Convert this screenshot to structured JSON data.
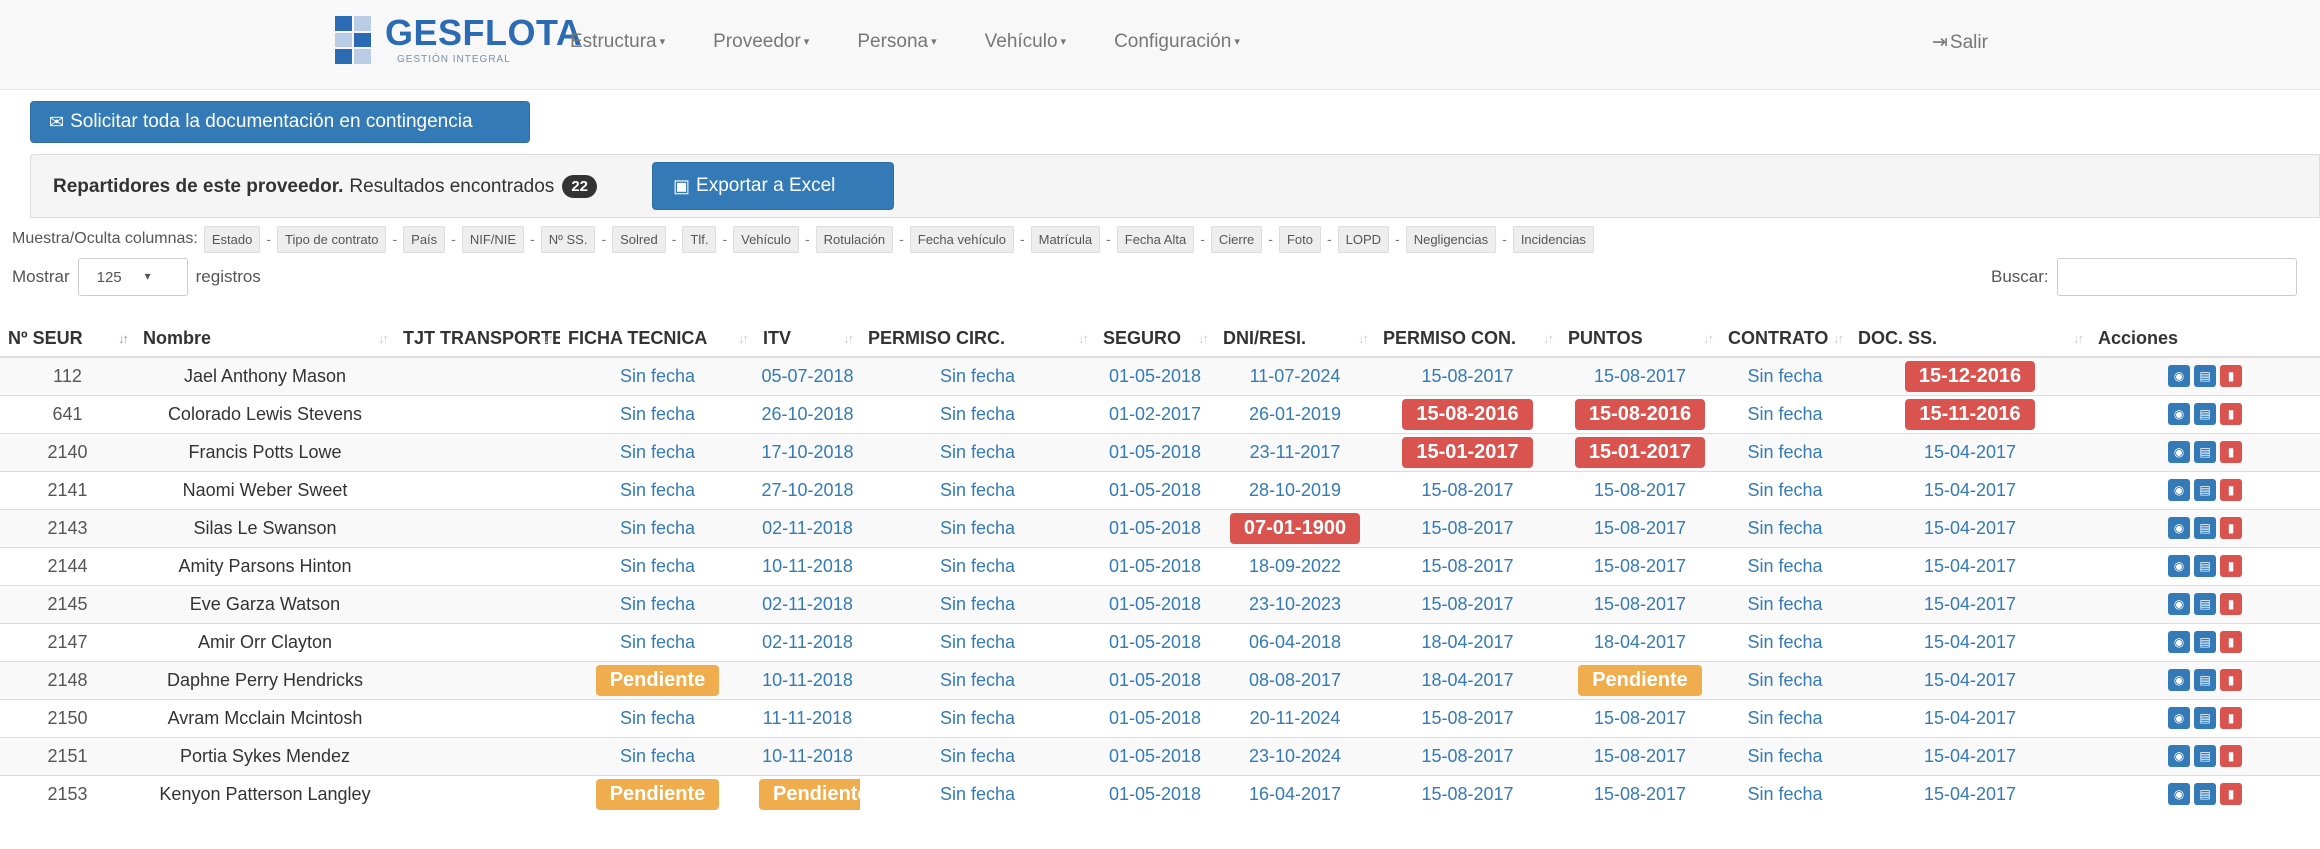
{
  "brand": {
    "name": "GESFLOTA",
    "subtitle": "GESTIÓN INTEGRAL"
  },
  "nav": {
    "items": [
      {
        "label": "Estructura"
      },
      {
        "label": "Proveedor"
      },
      {
        "label": "Persona"
      },
      {
        "label": "Vehículo"
      },
      {
        "label": "Configuración"
      }
    ],
    "logout": "Salir"
  },
  "contingency_button": "Solicitar toda la documentación en contingencia",
  "panel": {
    "title_bold": "Repartidores de este proveedor.",
    "title_rest": "Resultados encontrados",
    "count": "22",
    "export_label": "Exportar a Excel"
  },
  "column_toggle": {
    "label": "Muestra/Oculta columnas:",
    "items": [
      "Estado",
      "Tipo de contrato",
      "País",
      "NIF/NIE",
      "Nº SS.",
      "Solred",
      "Tlf.",
      "Vehículo",
      "Rotulación",
      "Fecha vehículo",
      "Matrícula",
      "Fecha Alta",
      "Cierre",
      "Foto",
      "LOPD",
      "Negligencias",
      "Incidencias"
    ]
  },
  "length": {
    "prefix": "Mostrar",
    "value": "125",
    "suffix": "registros"
  },
  "search": {
    "label": "Buscar:",
    "value": ""
  },
  "table": {
    "headers": [
      "Nº SEUR",
      "Nombre",
      "TJT TRANSPORTES",
      "FICHA TECNICA",
      "ITV",
      "PERMISO CIRC.",
      "SEGURO",
      "DNI/RESI.",
      "PERMISO CON.",
      "PUNTOS",
      "CONTRATO",
      "DOC. SS.",
      "Acciones"
    ],
    "rows": [
      {
        "seur": "112",
        "name": "Jael Anthony Mason",
        "tjt": "",
        "ficha": {
          "t": "Sin fecha",
          "s": "n"
        },
        "itv": {
          "t": "05-07-2018",
          "s": "n"
        },
        "circ": {
          "t": "Sin fecha",
          "s": "n"
        },
        "seguro": {
          "t": "01-05-2018",
          "s": "n"
        },
        "dni": {
          "t": "11-07-2024",
          "s": "n"
        },
        "pcon": {
          "t": "15-08-2017",
          "s": "n"
        },
        "puntos": {
          "t": "15-08-2017",
          "s": "n"
        },
        "contrato": {
          "t": "Sin fecha",
          "s": "n"
        },
        "docss": {
          "t": "15-12-2016",
          "s": "d"
        }
      },
      {
        "seur": "641",
        "name": "Colorado Lewis Stevens",
        "tjt": "",
        "ficha": {
          "t": "Sin fecha",
          "s": "n"
        },
        "itv": {
          "t": "26-10-2018",
          "s": "n"
        },
        "circ": {
          "t": "Sin fecha",
          "s": "n"
        },
        "seguro": {
          "t": "01-02-2017",
          "s": "n"
        },
        "dni": {
          "t": "26-01-2019",
          "s": "n"
        },
        "pcon": {
          "t": "15-08-2016",
          "s": "d"
        },
        "puntos": {
          "t": "15-08-2016",
          "s": "d"
        },
        "contrato": {
          "t": "Sin fecha",
          "s": "n"
        },
        "docss": {
          "t": "15-11-2016",
          "s": "d"
        }
      },
      {
        "seur": "2140",
        "name": "Francis Potts Lowe",
        "tjt": "",
        "ficha": {
          "t": "Sin fecha",
          "s": "n"
        },
        "itv": {
          "t": "17-10-2018",
          "s": "n"
        },
        "circ": {
          "t": "Sin fecha",
          "s": "n"
        },
        "seguro": {
          "t": "01-05-2018",
          "s": "n"
        },
        "dni": {
          "t": "23-11-2017",
          "s": "n"
        },
        "pcon": {
          "t": "15-01-2017",
          "s": "d"
        },
        "puntos": {
          "t": "15-01-2017",
          "s": "d"
        },
        "contrato": {
          "t": "Sin fecha",
          "s": "n"
        },
        "docss": {
          "t": "15-04-2017",
          "s": "n"
        }
      },
      {
        "seur": "2141",
        "name": "Naomi Weber Sweet",
        "tjt": "",
        "ficha": {
          "t": "Sin fecha",
          "s": "n"
        },
        "itv": {
          "t": "27-10-2018",
          "s": "n"
        },
        "circ": {
          "t": "Sin fecha",
          "s": "n"
        },
        "seguro": {
          "t": "01-05-2018",
          "s": "n"
        },
        "dni": {
          "t": "28-10-2019",
          "s": "n"
        },
        "pcon": {
          "t": "15-08-2017",
          "s": "n"
        },
        "puntos": {
          "t": "15-08-2017",
          "s": "n"
        },
        "contrato": {
          "t": "Sin fecha",
          "s": "n"
        },
        "docss": {
          "t": "15-04-2017",
          "s": "n"
        }
      },
      {
        "seur": "2143",
        "name": "Silas Le Swanson",
        "tjt": "",
        "ficha": {
          "t": "Sin fecha",
          "s": "n"
        },
        "itv": {
          "t": "02-11-2018",
          "s": "n"
        },
        "circ": {
          "t": "Sin fecha",
          "s": "n"
        },
        "seguro": {
          "t": "01-05-2018",
          "s": "n"
        },
        "dni": {
          "t": "07-01-1900",
          "s": "d"
        },
        "pcon": {
          "t": "15-08-2017",
          "s": "n"
        },
        "puntos": {
          "t": "15-08-2017",
          "s": "n"
        },
        "contrato": {
          "t": "Sin fecha",
          "s": "n"
        },
        "docss": {
          "t": "15-04-2017",
          "s": "n"
        }
      },
      {
        "seur": "2144",
        "name": "Amity Parsons Hinton",
        "tjt": "",
        "ficha": {
          "t": "Sin fecha",
          "s": "n"
        },
        "itv": {
          "t": "10-11-2018",
          "s": "n"
        },
        "circ": {
          "t": "Sin fecha",
          "s": "n"
        },
        "seguro": {
          "t": "01-05-2018",
          "s": "n"
        },
        "dni": {
          "t": "18-09-2022",
          "s": "n"
        },
        "pcon": {
          "t": "15-08-2017",
          "s": "n"
        },
        "puntos": {
          "t": "15-08-2017",
          "s": "n"
        },
        "contrato": {
          "t": "Sin fecha",
          "s": "n"
        },
        "docss": {
          "t": "15-04-2017",
          "s": "n"
        }
      },
      {
        "seur": "2145",
        "name": "Eve Garza Watson",
        "tjt": "",
        "ficha": {
          "t": "Sin fecha",
          "s": "n"
        },
        "itv": {
          "t": "02-11-2018",
          "s": "n"
        },
        "circ": {
          "t": "Sin fecha",
          "s": "n"
        },
        "seguro": {
          "t": "01-05-2018",
          "s": "n"
        },
        "dni": {
          "t": "23-10-2023",
          "s": "n"
        },
        "pcon": {
          "t": "15-08-2017",
          "s": "n"
        },
        "puntos": {
          "t": "15-08-2017",
          "s": "n"
        },
        "contrato": {
          "t": "Sin fecha",
          "s": "n"
        },
        "docss": {
          "t": "15-04-2017",
          "s": "n"
        }
      },
      {
        "seur": "2147",
        "name": "Amir Orr Clayton",
        "tjt": "",
        "ficha": {
          "t": "Sin fecha",
          "s": "n"
        },
        "itv": {
          "t": "02-11-2018",
          "s": "n"
        },
        "circ": {
          "t": "Sin fecha",
          "s": "n"
        },
        "seguro": {
          "t": "01-05-2018",
          "s": "n"
        },
        "dni": {
          "t": "06-04-2018",
          "s": "n"
        },
        "pcon": {
          "t": "18-04-2017",
          "s": "n"
        },
        "puntos": {
          "t": "18-04-2017",
          "s": "n"
        },
        "contrato": {
          "t": "Sin fecha",
          "s": "n"
        },
        "docss": {
          "t": "15-04-2017",
          "s": "n"
        }
      },
      {
        "seur": "2148",
        "name": "Daphne Perry Hendricks",
        "tjt": "",
        "ficha": {
          "t": "Pendiente",
          "s": "w"
        },
        "itv": {
          "t": "10-11-2018",
          "s": "n"
        },
        "circ": {
          "t": "Sin fecha",
          "s": "n"
        },
        "seguro": {
          "t": "01-05-2018",
          "s": "n"
        },
        "dni": {
          "t": "08-08-2017",
          "s": "n"
        },
        "pcon": {
          "t": "18-04-2017",
          "s": "n"
        },
        "puntos": {
          "t": "Pendiente",
          "s": "w"
        },
        "contrato": {
          "t": "Sin fecha",
          "s": "n"
        },
        "docss": {
          "t": "15-04-2017",
          "s": "n"
        }
      },
      {
        "seur": "2150",
        "name": "Avram Mcclain Mcintosh",
        "tjt": "",
        "ficha": {
          "t": "Sin fecha",
          "s": "n"
        },
        "itv": {
          "t": "11-11-2018",
          "s": "n"
        },
        "circ": {
          "t": "Sin fecha",
          "s": "n"
        },
        "seguro": {
          "t": "01-05-2018",
          "s": "n"
        },
        "dni": {
          "t": "20-11-2024",
          "s": "n"
        },
        "pcon": {
          "t": "15-08-2017",
          "s": "n"
        },
        "puntos": {
          "t": "15-08-2017",
          "s": "n"
        },
        "contrato": {
          "t": "Sin fecha",
          "s": "n"
        },
        "docss": {
          "t": "15-04-2017",
          "s": "n"
        }
      },
      {
        "seur": "2151",
        "name": "Portia Sykes Mendez",
        "tjt": "",
        "ficha": {
          "t": "Sin fecha",
          "s": "n"
        },
        "itv": {
          "t": "10-11-2018",
          "s": "n"
        },
        "circ": {
          "t": "Sin fecha",
          "s": "n"
        },
        "seguro": {
          "t": "01-05-2018",
          "s": "n"
        },
        "dni": {
          "t": "23-10-2024",
          "s": "n"
        },
        "pcon": {
          "t": "15-08-2017",
          "s": "n"
        },
        "puntos": {
          "t": "15-08-2017",
          "s": "n"
        },
        "contrato": {
          "t": "Sin fecha",
          "s": "n"
        },
        "docss": {
          "t": "15-04-2017",
          "s": "n"
        }
      },
      {
        "seur": "2153",
        "name": "Kenyon Patterson Langley",
        "tjt": "",
        "ficha": {
          "t": "Pendiente",
          "s": "w"
        },
        "itv": {
          "t": "Pendiente",
          "s": "w"
        },
        "circ": {
          "t": "Sin fecha",
          "s": "n"
        },
        "seguro": {
          "t": "01-05-2018",
          "s": "n"
        },
        "dni": {
          "t": "16-04-2017",
          "s": "n"
        },
        "pcon": {
          "t": "15-08-2017",
          "s": "n"
        },
        "puntos": {
          "t": "15-08-2017",
          "s": "n"
        },
        "contrato": {
          "t": "Sin fecha",
          "s": "n"
        },
        "docss": {
          "t": "15-04-2017",
          "s": "n"
        }
      }
    ]
  },
  "icons": {
    "view": "eye-icon",
    "doc": "document-icon",
    "delete": "trash-icon",
    "logout": "sign-out-icon",
    "mail": "envelope-icon",
    "excel": "excel-file-icon"
  },
  "colors": {
    "primary": "#337ab7",
    "danger": "#d9534f",
    "warning": "#f0ad4e",
    "brand": "#2a6bb3"
  }
}
